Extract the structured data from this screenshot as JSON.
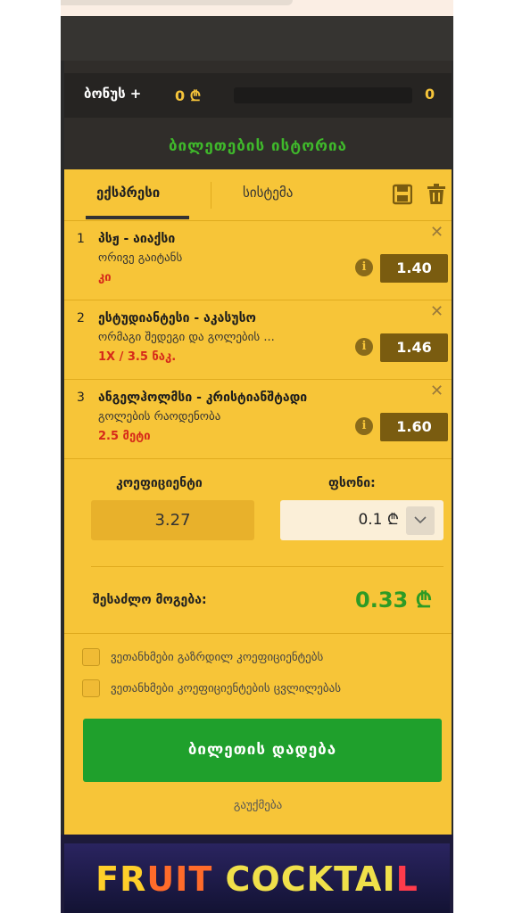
{
  "bonus": {
    "label": "ბონუს +",
    "amount": "0 ₾",
    "count": "0"
  },
  "history_label": "ბილეთების ისტორია",
  "tabs": [
    {
      "label": "ექსპრესი",
      "active": true
    },
    {
      "label": "სისტემა",
      "active": false
    }
  ],
  "toolbar_icons": [
    "save-icon",
    "trash-icon"
  ],
  "bets": [
    {
      "num": "1",
      "match": "პსჟ - აიაქსი",
      "market": "ორივე გაიტანს",
      "pick": "კი",
      "odds": "1.40"
    },
    {
      "num": "2",
      "match": "ესტუდიანტესი - აკასუსო",
      "market": "ორმაგი შედეგი და გოლების ...",
      "pick": "1X / 3.5 ნაკ.",
      "odds": "1.46"
    },
    {
      "num": "3",
      "match": "ანგელჰოლმსი - კრისტიანშტადი",
      "market": "გოლების რაოდენობა",
      "pick": "2.5 მეტი",
      "odds": "1.60"
    }
  ],
  "summary": {
    "coef_label": "კოეფიციენტი",
    "coef_value": "3.27",
    "stake_label": "ფსონი:",
    "stake_value": "0.1 ₾",
    "win_label": "შესაძლო მოგება:",
    "win_value": "0.33 ₾"
  },
  "checkboxes": [
    {
      "label": "ვეთანხმები გაზრდილ კოეფიციენტებს",
      "checked": false
    },
    {
      "label": "ვეთანხმები კოეფიციენტების ცვლილებას",
      "checked": false
    }
  ],
  "place_bet_label": "ბილეთის დადება",
  "cancel_label": "გაუქმება",
  "banner": {
    "part1": "FR",
    "part2": "UIT ",
    "part3": "COCKTAI",
    "part4": "L"
  },
  "colors": {
    "slip_bg": "#f7c538",
    "odds_bg": "#7a5c10",
    "accent_green": "#1fa02c",
    "pick_red": "#d62a1a"
  }
}
